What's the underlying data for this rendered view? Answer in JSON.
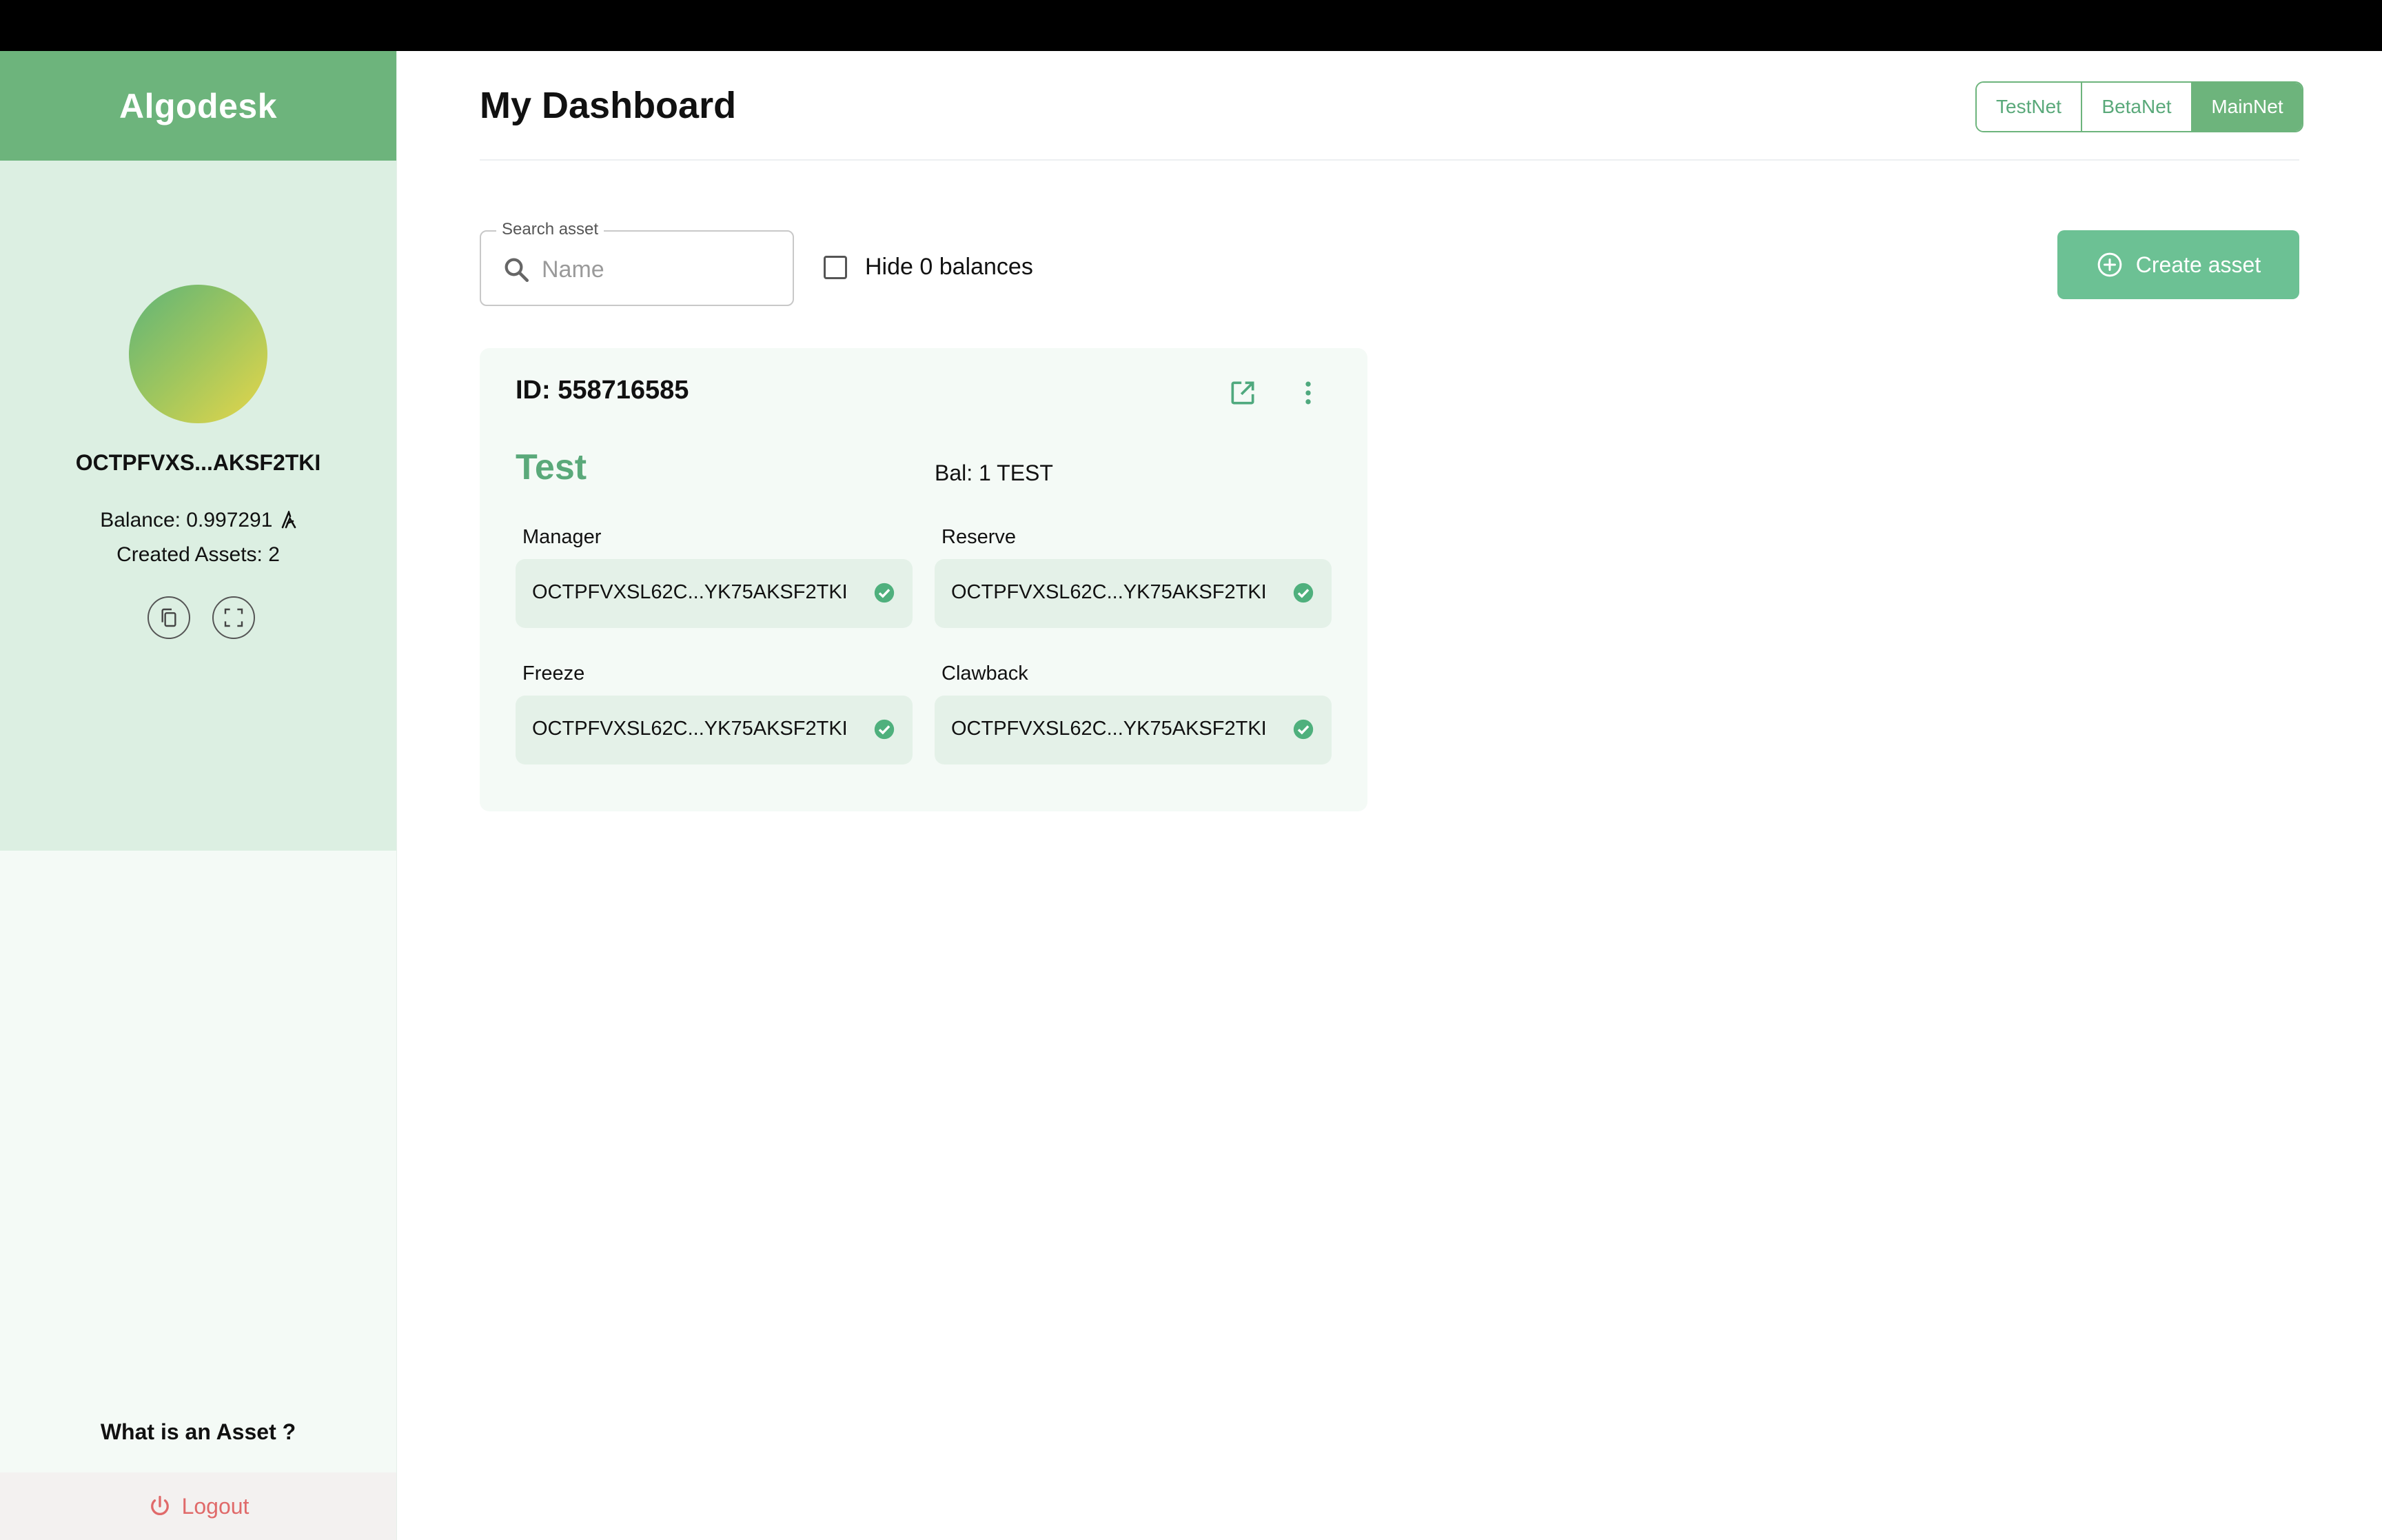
{
  "app": {
    "name": "Algodesk"
  },
  "sidebar": {
    "address": "OCTPFVXS...AKSF2TKI",
    "balance": "Balance: 0.997291",
    "created_assets": "Created Assets: 2",
    "help_link": "What is an Asset ?",
    "logout_label": "Logout"
  },
  "header": {
    "title": "My Dashboard",
    "networks": [
      {
        "label": "TestNet",
        "active": false
      },
      {
        "label": "BetaNet",
        "active": false
      },
      {
        "label": "MainNet",
        "active": true
      }
    ]
  },
  "toolbar": {
    "search_label": "Search asset",
    "search_placeholder": "Name",
    "hide_zero_label": "Hide 0 balances",
    "hide_zero_checked": false,
    "create_label": "Create asset"
  },
  "asset": {
    "id_text": "ID: 558716585",
    "name": "Test",
    "balance": "Bal: 1 TEST",
    "fields": [
      {
        "label": "Manager",
        "value": "OCTPFVXSL62C...YK75AKSF2TKI"
      },
      {
        "label": "Reserve",
        "value": "OCTPFVXSL62C...YK75AKSF2TKI"
      },
      {
        "label": "Freeze",
        "value": "OCTPFVXSL62C...YK75AKSF2TKI"
      },
      {
        "label": "Clawback",
        "value": "OCTPFVXSL62C...YK75AKSF2TKI"
      }
    ]
  },
  "colors": {
    "brand": "#6db47c",
    "accent": "#5aa97a",
    "create_button": "#6cc194",
    "logout": "#e06a6a"
  },
  "icons": {
    "algo": "algo-icon",
    "copy": "copy-icon",
    "scan": "qr-scan-icon",
    "logout": "power-icon",
    "search": "search-icon",
    "create": "plus-circle-icon",
    "open": "open-external-icon",
    "menu": "more-vert-icon",
    "verified": "check-circle-icon"
  }
}
